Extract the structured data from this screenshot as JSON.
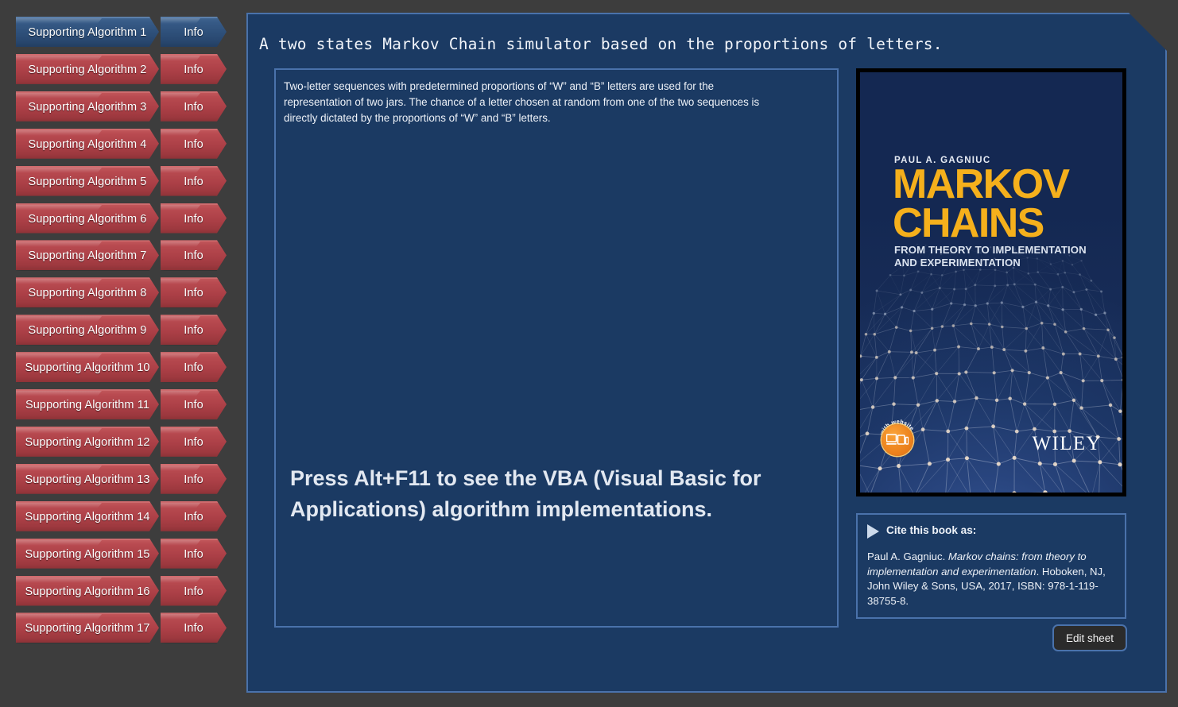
{
  "colors": {
    "page_background": "#3d3d3d",
    "panel_background": "#1b3a63",
    "panel_border": "#4a72ab",
    "accent_selected": "#2d4e78",
    "accent_item": "#ab3f46",
    "book_title_gold": "#f5b01c",
    "book_background": "#1b3462",
    "button_background": "#2b2b2b"
  },
  "sidebar": {
    "items": [
      {
        "label": "Supporting Algorithm 1",
        "info_label": "Info",
        "selected": true
      },
      {
        "label": "Supporting Algorithm 2",
        "info_label": "Info",
        "selected": false
      },
      {
        "label": "Supporting Algorithm 3",
        "info_label": "Info",
        "selected": false
      },
      {
        "label": "Supporting Algorithm 4",
        "info_label": "Info",
        "selected": false
      },
      {
        "label": "Supporting Algorithm 5",
        "info_label": "Info",
        "selected": false
      },
      {
        "label": "Supporting Algorithm 6",
        "info_label": "Info",
        "selected": false
      },
      {
        "label": "Supporting Algorithm 7",
        "info_label": "Info",
        "selected": false
      },
      {
        "label": "Supporting Algorithm 8",
        "info_label": "Info",
        "selected": false
      },
      {
        "label": "Supporting Algorithm 9",
        "info_label": "Info",
        "selected": false
      },
      {
        "label": "Supporting Algorithm 10",
        "info_label": "Info",
        "selected": false
      },
      {
        "label": "Supporting Algorithm 11",
        "info_label": "Info",
        "selected": false
      },
      {
        "label": "Supporting Algorithm 12",
        "info_label": "Info",
        "selected": false
      },
      {
        "label": "Supporting Algorithm 13",
        "info_label": "Info",
        "selected": false
      },
      {
        "label": "Supporting Algorithm 14",
        "info_label": "Info",
        "selected": false
      },
      {
        "label": "Supporting Algorithm 15",
        "info_label": "Info",
        "selected": false
      },
      {
        "label": "Supporting Algorithm 16",
        "info_label": "Info",
        "selected": false
      },
      {
        "label": "Supporting Algorithm 17",
        "info_label": "Info",
        "selected": false
      }
    ]
  },
  "panel": {
    "title": "A two states Markov Chain simulator based on the proportions of letters.",
    "description": "Two-letter sequences with predetermined proportions of “W” and “B” letters are used for the representation of two jars. The chance of a letter chosen at random from one of the two sequences is directly dictated by the proportions of “W” and “B” letters.",
    "vba_note": "Press Alt+F11 to see the VBA (Visual Basic for Applications) algorithm implementations."
  },
  "book": {
    "author": "PAUL A. GAGNIUC",
    "title_line1": "MARKOV",
    "title_line2": "CHAINS",
    "subtitle": "FROM THEORY TO IMPLEMENTATION AND EXPERIMENTATION",
    "publisher": "WILEY",
    "badge_text": "with website"
  },
  "citation": {
    "heading": "Cite this book as:",
    "author": "Paul A. Gagniuc.",
    "work_title": "Markov chains: from theory to implementation and experimentation",
    "publication": ". Hoboken, NJ, John Wiley & Sons, USA, 2017, ISBN: 978-1-119-38755-8."
  },
  "buttons": {
    "edit_sheet": "Edit sheet"
  }
}
